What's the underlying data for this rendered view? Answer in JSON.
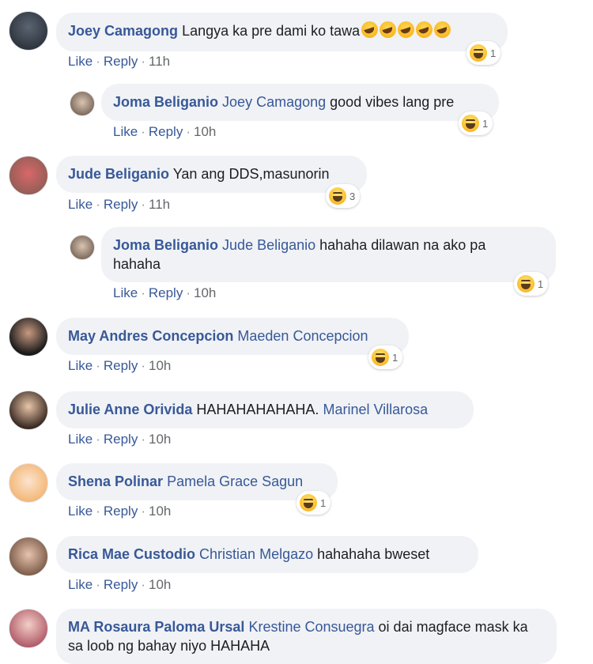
{
  "comments": [
    {
      "author": "Joey Camagong",
      "mention": "",
      "text": "Langya ka pre dami ko tawa",
      "like": "Like",
      "reply": "Reply",
      "time": "11h",
      "reactions": "1"
    },
    {
      "author": "Joma Beliganio",
      "mention": "Joey Camagong",
      "text": "good vibes lang pre",
      "like": "Like",
      "reply": "Reply",
      "time": "10h",
      "reactions": "1"
    },
    {
      "author": "Jude Beliganio",
      "mention": "",
      "text": "Yan ang DDS,masunorin",
      "like": "Like",
      "reply": "Reply",
      "time": "11h",
      "reactions": "3"
    },
    {
      "author": "Joma Beliganio",
      "mention": "Jude Beliganio",
      "text": "hahaha dilawan na ako pa hahaha",
      "like": "Like",
      "reply": "Reply",
      "time": "10h",
      "reactions": "1"
    },
    {
      "author": "May Andres Concepcion",
      "mention": "Maeden Concepcion",
      "text": "",
      "like": "Like",
      "reply": "Reply",
      "time": "10h",
      "reactions": "1"
    },
    {
      "author": "Julie Anne Orivida",
      "mention": "Marinel Villarosa",
      "text": "HAHAHAHAHAHA.",
      "like": "Like",
      "reply": "Reply",
      "time": "10h",
      "reactions": ""
    },
    {
      "author": "Shena Polinar",
      "mention": "Pamela Grace Sagun",
      "text": "",
      "like": "Like",
      "reply": "Reply",
      "time": "10h",
      "reactions": "1"
    },
    {
      "author": "Rica Mae Custodio",
      "mention": "Christian Melgazo",
      "text": "hahahaha bweset",
      "like": "Like",
      "reply": "Reply",
      "time": "10h",
      "reactions": ""
    },
    {
      "author": "MA Rosaura Paloma Ursal",
      "mention": "Krestine Consuegra",
      "text": "oi dai magface mask ka sa loob ng bahay niyo HAHAHA",
      "like": "",
      "reply": "",
      "time": "",
      "reactions": ""
    }
  ],
  "theme": {
    "link": "#385898",
    "bubble": "#f0f2f5",
    "time": "#65676b"
  },
  "icons": {
    "reaction": "haha-react-icon",
    "inline_emoji": "rofl-emoji-icon"
  }
}
